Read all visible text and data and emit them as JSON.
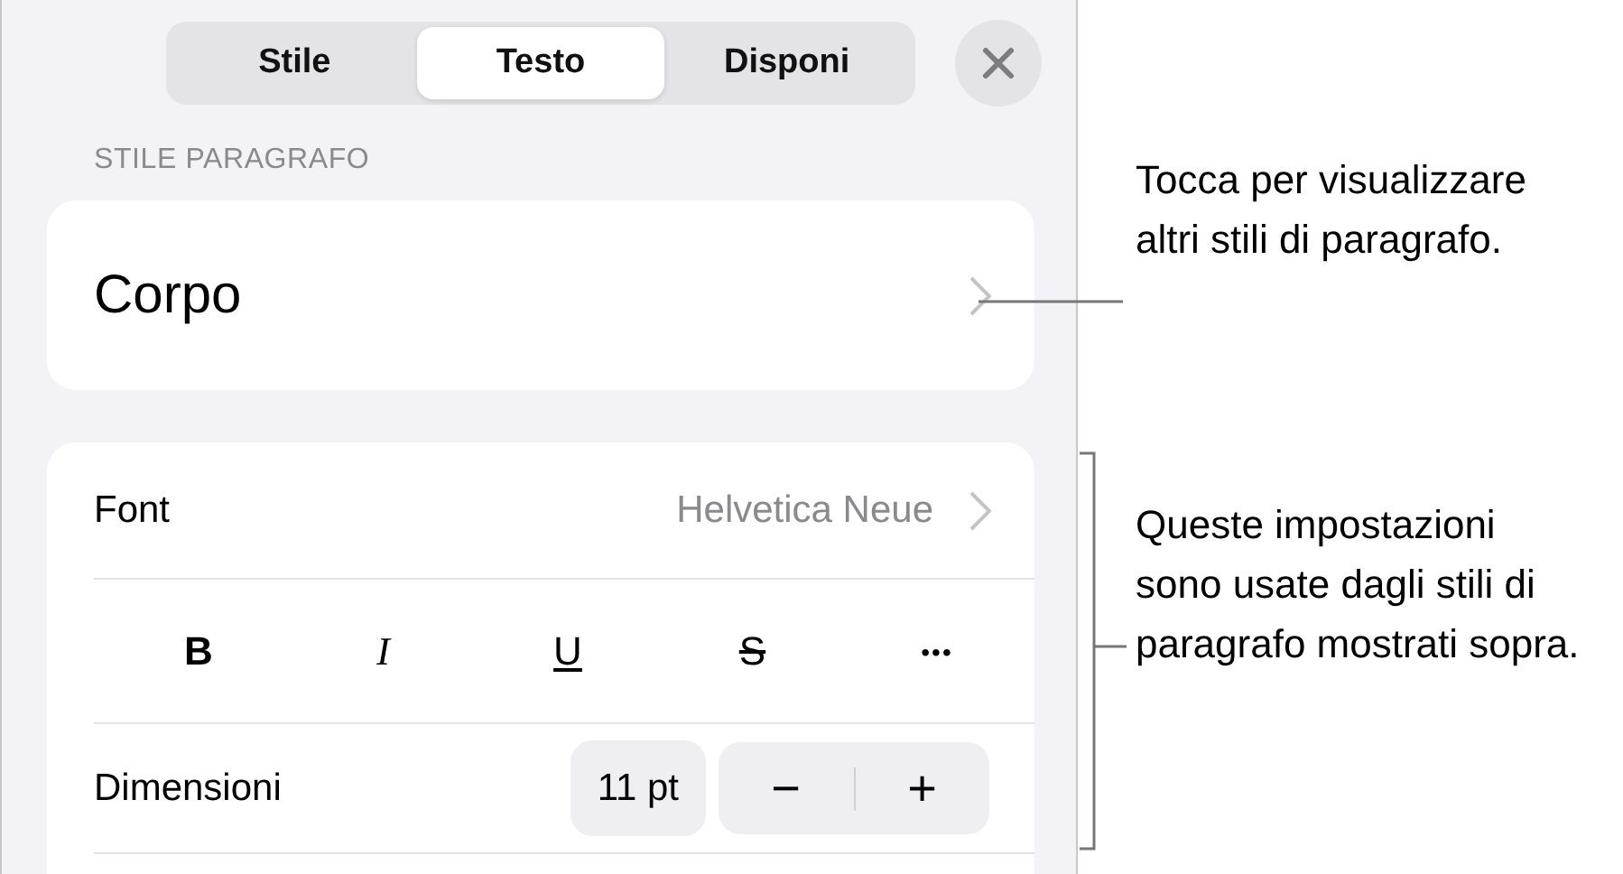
{
  "tabs": [
    {
      "label": "Stile",
      "selected": false
    },
    {
      "label": "Testo",
      "selected": true
    },
    {
      "label": "Disponi",
      "selected": false
    }
  ],
  "section_header": "STILE PARAGRAFO",
  "paragraph_style": {
    "value": "Corpo"
  },
  "font_row": {
    "label": "Font",
    "value": "Helvetica Neue"
  },
  "format_buttons": [
    {
      "kind": "bold",
      "label": "B"
    },
    {
      "kind": "italic",
      "label": "I"
    },
    {
      "kind": "underline",
      "label": "U"
    },
    {
      "kind": "strike",
      "label": "S"
    },
    {
      "kind": "more",
      "label": "•••"
    }
  ],
  "size_row": {
    "label": "Dimensioni",
    "value": "11 pt",
    "decrease": "−",
    "increase": "+"
  },
  "callouts": [
    {
      "text": "Tocca per visualizzare altri stili di paragrafo."
    },
    {
      "text": "Queste impostazioni sono usate dagli stili di paragrafo mostrati sopra."
    }
  ]
}
